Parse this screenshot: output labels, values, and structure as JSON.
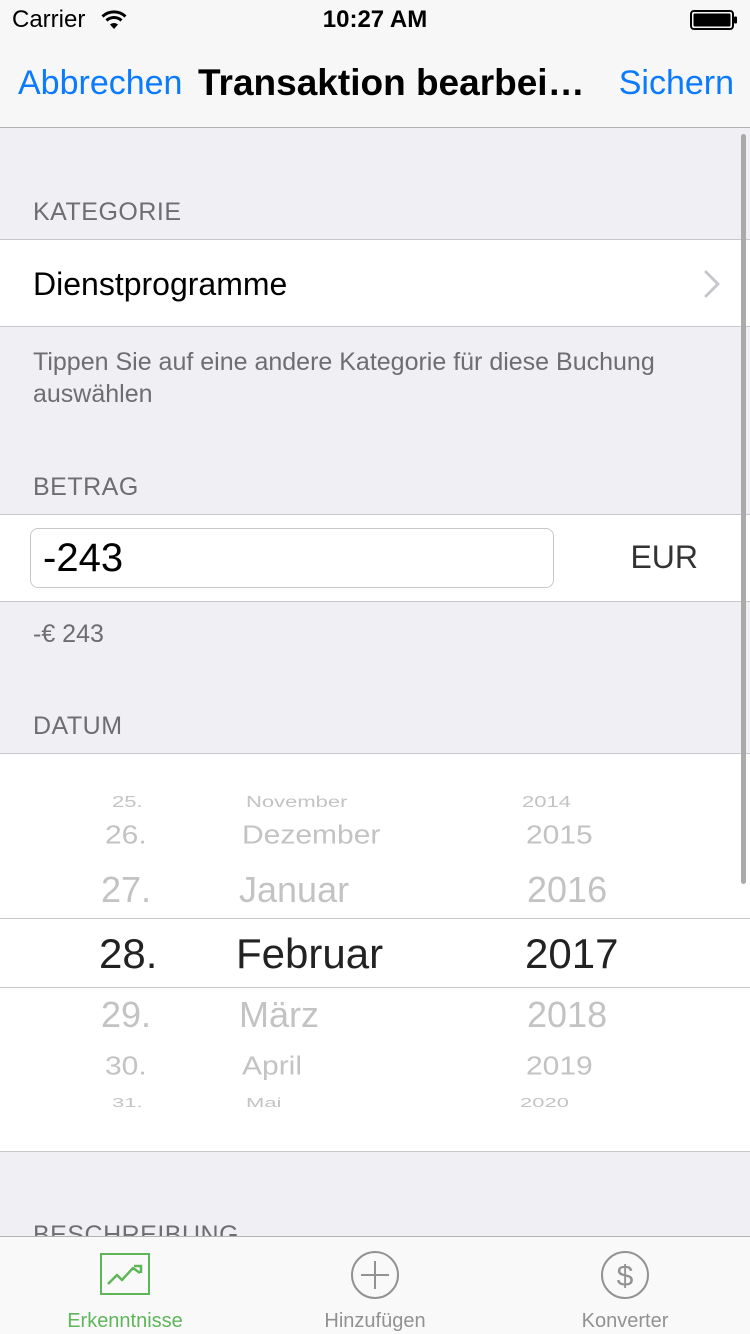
{
  "status_bar": {
    "carrier": "Carrier",
    "time": "10:27 AM"
  },
  "nav": {
    "cancel": "Abbrechen",
    "title": "Transaktion bearbeiten",
    "save": "Sichern"
  },
  "category": {
    "header": "KATEGORIE",
    "value": "Dienstprogramme",
    "hint": "Tippen Sie auf eine andere Kategorie für diese Buchung auswählen"
  },
  "amount": {
    "header": "BETRAG",
    "value": "-243",
    "currency": "EUR",
    "formatted": "-€ 243"
  },
  "date": {
    "header": "DATUM",
    "days": [
      "25.",
      "26.",
      "27.",
      "28.",
      "29.",
      "30.",
      "31."
    ],
    "months": [
      "November",
      "Dezember",
      "Januar",
      "Februar",
      "März",
      "April",
      "Mai"
    ],
    "years": [
      "2014",
      "2015",
      "2016",
      "2017",
      "2018",
      "2019",
      "2020"
    ],
    "selected": {
      "day": "28.",
      "month": "Februar",
      "year": "2017"
    }
  },
  "description": {
    "header": "BESCHREIBUNG"
  },
  "tabs": [
    {
      "label": "Erkenntnisse",
      "icon": "chart-icon",
      "active": true
    },
    {
      "label": "Hinzufügen",
      "icon": "plus-circle-icon",
      "active": false
    },
    {
      "label": "Konverter",
      "icon": "dollar-circle-icon",
      "active": false
    }
  ],
  "colors": {
    "accent": "#0a7aff",
    "tab_active": "#5fb65a",
    "background": "#efeff4"
  }
}
